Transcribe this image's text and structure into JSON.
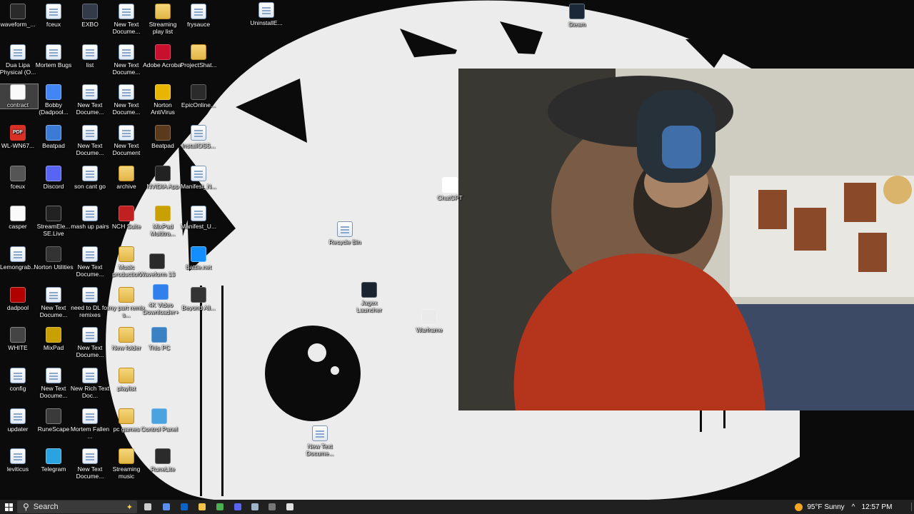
{
  "desktop": {
    "icons": [
      {
        "label": "waveform_...",
        "glyph": "waveform-icon",
        "style": "round",
        "color": "#2a2a2a"
      },
      {
        "label": "fceux",
        "glyph": "document-icon",
        "style": "doc"
      },
      {
        "label": "EXBO",
        "glyph": "app-icon",
        "style": "app",
        "color": "#333a4a"
      },
      {
        "label": "New Text Docume...",
        "glyph": "text-file-icon",
        "style": "doc"
      },
      {
        "label": "Streaming play list",
        "glyph": "folder-icon",
        "style": "folder"
      },
      {
        "label": "frysauce",
        "glyph": "text-file-icon",
        "style": "doc"
      },
      {
        "label": "UninstallE...",
        "glyph": "installer-icon",
        "style": "doc"
      },
      {
        "label": "Steam",
        "glyph": "steam-icon",
        "style": "round",
        "color": "#1b2838"
      },
      {
        "label": "Dua Lipa Physical (O...",
        "glyph": "audio-file-icon",
        "style": "doc"
      },
      {
        "label": "Mortem Bugs",
        "glyph": "text-file-icon",
        "style": "doc"
      },
      {
        "label": "list",
        "glyph": "text-file-icon",
        "style": "doc"
      },
      {
        "label": "New Text Docume...",
        "glyph": "text-file-icon",
        "style": "doc"
      },
      {
        "label": "Adobe Acrobat",
        "glyph": "acrobat-icon",
        "style": "app",
        "color": "#c8102e"
      },
      {
        "label": "ProjectShat...",
        "glyph": "folder-icon",
        "style": "folder"
      },
      {
        "label": "contract",
        "glyph": "blank-file-icon",
        "style": "blank",
        "selected": true
      },
      {
        "label": "Bobby (Dadpool...",
        "glyph": "chrome-icon",
        "style": "round",
        "color": "#4285f4"
      },
      {
        "label": "New Text Docume...",
        "glyph": "text-file-icon",
        "style": "doc"
      },
      {
        "label": "New Text Docume...",
        "glyph": "text-file-icon",
        "style": "doc"
      },
      {
        "label": "Norton AntiVirus",
        "glyph": "norton-icon",
        "style": "round",
        "color": "#e8b500"
      },
      {
        "label": "EpicOnline...",
        "glyph": "epic-games-icon",
        "style": "app",
        "color": "#2b2b2b"
      },
      {
        "label": "WL-WN67...",
        "glyph": "pdf-icon",
        "style": "pdf"
      },
      {
        "label": "Beatpad",
        "glyph": "beatpad-icon",
        "style": "round",
        "color": "#3a7bd5"
      },
      {
        "label": "New Text Docume...",
        "glyph": "text-file-icon",
        "style": "doc"
      },
      {
        "label": "New Text Document",
        "glyph": "text-file-icon",
        "style": "doc"
      },
      {
        "label": "Beatpad",
        "glyph": "beatpad-icon",
        "style": "app",
        "color": "#5a3a1a"
      },
      {
        "label": "InstallOSS...",
        "glyph": "installer-icon",
        "style": "doc"
      },
      {
        "label": "fceux",
        "glyph": "joystick-icon",
        "style": "app",
        "color": "#555"
      },
      {
        "label": "Discord",
        "glyph": "discord-icon",
        "style": "round",
        "color": "#5865f2"
      },
      {
        "label": "son cant go",
        "glyph": "text-file-icon",
        "style": "doc"
      },
      {
        "label": "archive",
        "glyph": "folder-icon",
        "style": "folder"
      },
      {
        "label": "NVIDIA App",
        "glyph": "nvidia-icon",
        "style": "app",
        "color": "#222"
      },
      {
        "label": "Manifest_N...",
        "glyph": "text-file-icon",
        "style": "doc"
      },
      {
        "label": "ChatGPT",
        "glyph": "chatgpt-icon",
        "style": "round",
        "color": "#ffffff"
      },
      {
        "label": "casper",
        "glyph": "blank-file-icon",
        "style": "blank"
      },
      {
        "label": "StreamEle... SE.Live",
        "glyph": "streamelements-icon",
        "style": "round",
        "color": "#222"
      },
      {
        "label": "mash up pairs",
        "glyph": "text-file-icon",
        "style": "doc"
      },
      {
        "label": "NCH Suite",
        "glyph": "nch-icon",
        "style": "app",
        "color": "#c02020"
      },
      {
        "label": "MixPad Multitra...",
        "glyph": "mixpad-icon",
        "style": "app",
        "color": "#c8a000"
      },
      {
        "label": "Manifest_U...",
        "glyph": "text-file-icon",
        "style": "doc"
      },
      {
        "label": "Recycle Bin",
        "glyph": "recycle-bin-icon",
        "style": "doc"
      },
      {
        "label": "Lemongrab...",
        "glyph": "audio-file-icon",
        "style": "doc"
      },
      {
        "label": "Norton Utilities",
        "glyph": "norton-icon",
        "style": "app",
        "color": "#333"
      },
      {
        "label": "New Text Docume...",
        "glyph": "text-file-icon",
        "style": "doc"
      },
      {
        "label": "Music production",
        "glyph": "folder-icon",
        "style": "folder"
      },
      {
        "label": "Waveform 13",
        "glyph": "waveform-icon",
        "style": "round",
        "color": "#2a2a2a"
      },
      {
        "label": "Battle.net",
        "glyph": "battlenet-icon",
        "style": "round",
        "color": "#148eff"
      },
      {
        "label": "dadpool",
        "glyph": "dadpool-icon",
        "style": "round",
        "color": "#b00000"
      },
      {
        "label": "New Text Docume...",
        "glyph": "text-file-icon",
        "style": "doc"
      },
      {
        "label": "need to DL for remixes",
        "glyph": "text-file-icon",
        "style": "doc"
      },
      {
        "label": "my part remix s...",
        "glyph": "folder-icon",
        "style": "folder"
      },
      {
        "label": "4K Video Downloader+",
        "glyph": "downloader-icon",
        "style": "app",
        "color": "#2f80ed"
      },
      {
        "label": "Beyond All...",
        "glyph": "bar-game-icon",
        "style": "app",
        "color": "#333"
      },
      {
        "label": "Jagex Launcher",
        "glyph": "jagex-icon",
        "style": "app",
        "color": "#1a2330"
      },
      {
        "label": "WHITE",
        "glyph": "cat-icon",
        "style": "round",
        "color": "#444"
      },
      {
        "label": "MixPad",
        "glyph": "mixpad-icon",
        "style": "app",
        "color": "#c8a000"
      },
      {
        "label": "New Text Docume...",
        "glyph": "text-file-icon",
        "style": "doc"
      },
      {
        "label": "New folder",
        "glyph": "folder-icon",
        "style": "folder"
      },
      {
        "label": "This PC",
        "glyph": "computer-icon",
        "style": "app",
        "color": "#3b82c4"
      },
      {
        "label": "Warframe",
        "glyph": "warframe-icon",
        "style": "round",
        "color": "#eaeaea"
      },
      {
        "label": "config",
        "glyph": "config-file-icon",
        "style": "doc"
      },
      {
        "label": "New Text Docume...",
        "glyph": "text-file-icon",
        "style": "doc"
      },
      {
        "label": "New Rich Text Doc...",
        "glyph": "word-doc-icon",
        "style": "doc"
      },
      {
        "label": "playlist",
        "glyph": "folder-icon",
        "style": "folder"
      },
      {
        "label": "updater",
        "glyph": "updater-icon",
        "style": "doc"
      },
      {
        "label": "RuneScape",
        "glyph": "runescape-icon",
        "style": "round",
        "color": "#3a3a3a"
      },
      {
        "label": "Mortem Fallen ...",
        "glyph": "text-file-icon",
        "style": "doc"
      },
      {
        "label": "pc games",
        "glyph": "folder-icon",
        "style": "folder"
      },
      {
        "label": "Control Panel",
        "glyph": "control-panel-icon",
        "style": "app",
        "color": "#4aa3df"
      },
      {
        "label": "New Text Docume...",
        "glyph": "text-file-icon",
        "style": "doc"
      },
      {
        "label": "leviticus",
        "glyph": "document-icon",
        "style": "doc"
      },
      {
        "label": "Telegram",
        "glyph": "telegram-icon",
        "style": "round",
        "color": "#2aa3e0"
      },
      {
        "label": "New Text Docume...",
        "glyph": "text-file-icon",
        "style": "doc"
      },
      {
        "label": "Streaming music",
        "glyph": "folder-icon",
        "style": "folder"
      },
      {
        "label": "RuneLite",
        "glyph": "runelite-icon",
        "style": "app",
        "color": "#2b2b2b"
      }
    ]
  },
  "webcam": {
    "glyph": "webcam-feed"
  },
  "taskbar": {
    "search_placeholder": "Search",
    "weather": "95°F  Sunny",
    "clock": "12:57 PM",
    "tray_chevron": "^",
    "pinned": [
      {
        "name": "task-view-icon",
        "color": "#cccccc"
      },
      {
        "name": "waveform-taskbar-icon",
        "color": "#5b8ef0"
      },
      {
        "name": "outlook-icon",
        "color": "#0a64c8"
      },
      {
        "name": "file-explorer-icon",
        "color": "#f3c34b"
      },
      {
        "name": "chrome-taskbar-icon",
        "color": "#4caf50"
      },
      {
        "name": "discord-taskbar-icon",
        "color": "#5865f2"
      },
      {
        "name": "steam-taskbar-icon",
        "color": "#9fb3c8"
      },
      {
        "name": "obs-icon",
        "color": "#777777"
      },
      {
        "name": "chatgpt-taskbar-icon",
        "color": "#e0e0e0"
      }
    ]
  }
}
